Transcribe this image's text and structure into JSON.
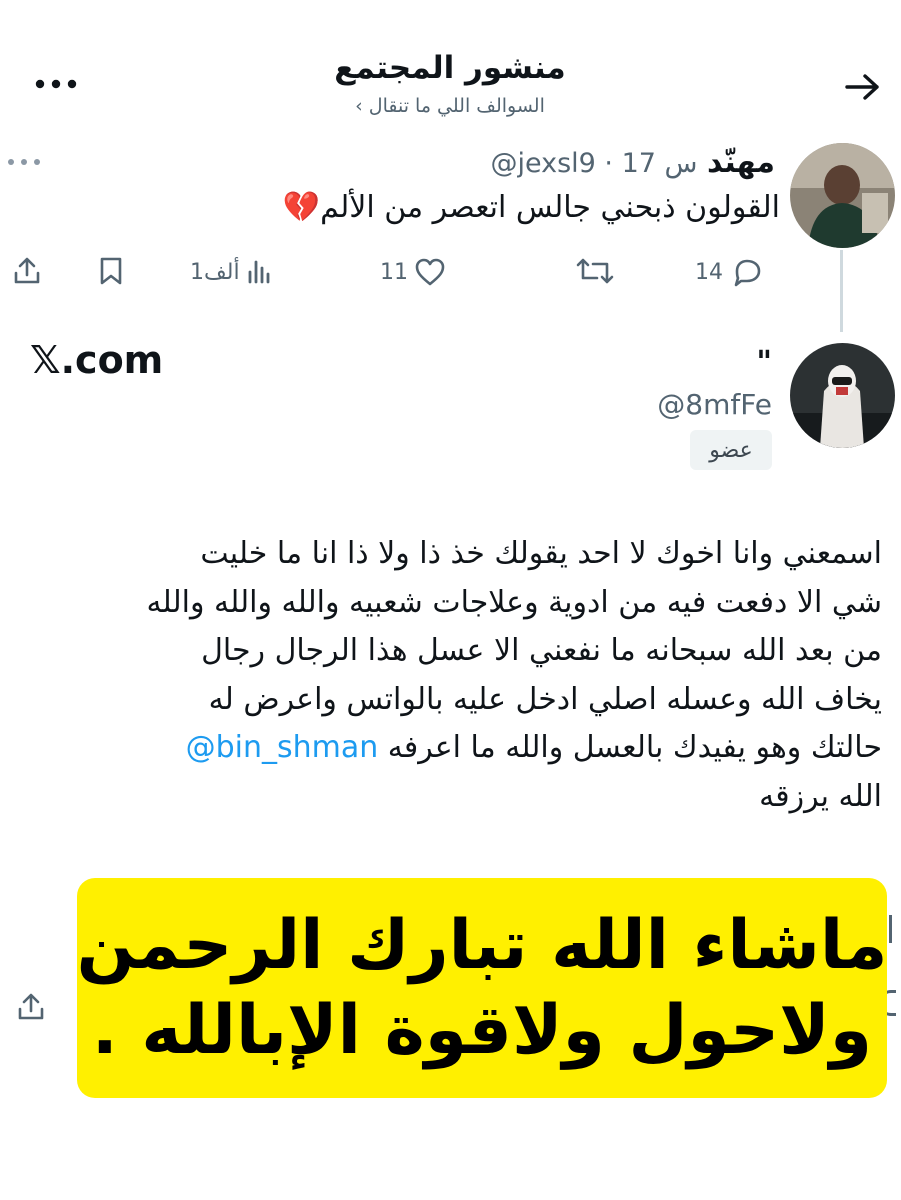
{
  "header": {
    "title": "منشور المجتمع",
    "subtitle": "السوالف اللي ما تنقال ›",
    "back_icon": "arrow-right-icon",
    "more_icon": "more-horizontal-icon"
  },
  "post1": {
    "author_name": "مهنّد",
    "handle_time": "@jexsl9 · 17 س",
    "text": "القولون ذبحني جالس اتعصر من الألم",
    "emoji": "💔",
    "actions": {
      "replies": "14",
      "retweets": "",
      "likes": "11",
      "views": "1ألف"
    }
  },
  "watermark": "𝕏.com",
  "post2": {
    "author_name": "\"",
    "handle": "@8mfFe",
    "badge": "عضو",
    "text_lines": [
      "اسمعني وانا اخوك لا احد يقولك خذ ذا ولا ذا انا ما خليت",
      "شي الا دفعت فيه من ادوية وعلاجات شعبيه والله والله والله",
      "من بعد الله سبحانه ما نفعني الا عسل هذا الرجال رجال",
      "يخاف الله وعسله اصلي ادخل عليه بالواتس واعرض له"
    ],
    "line5_text": "حالتك وهو يفيدك بالعسل والله ما اعرفه",
    "mention": "@bin_shman",
    "line6_text": "الله يرزقه"
  },
  "overlay": {
    "line1": "ماشاء الله تبارك الرحمن",
    "line2": "ولاحول ولاقوة الإبالله ."
  },
  "colors": {
    "accent": "#1d9bf0",
    "highlight": "#fff000",
    "muted": "#536471"
  }
}
